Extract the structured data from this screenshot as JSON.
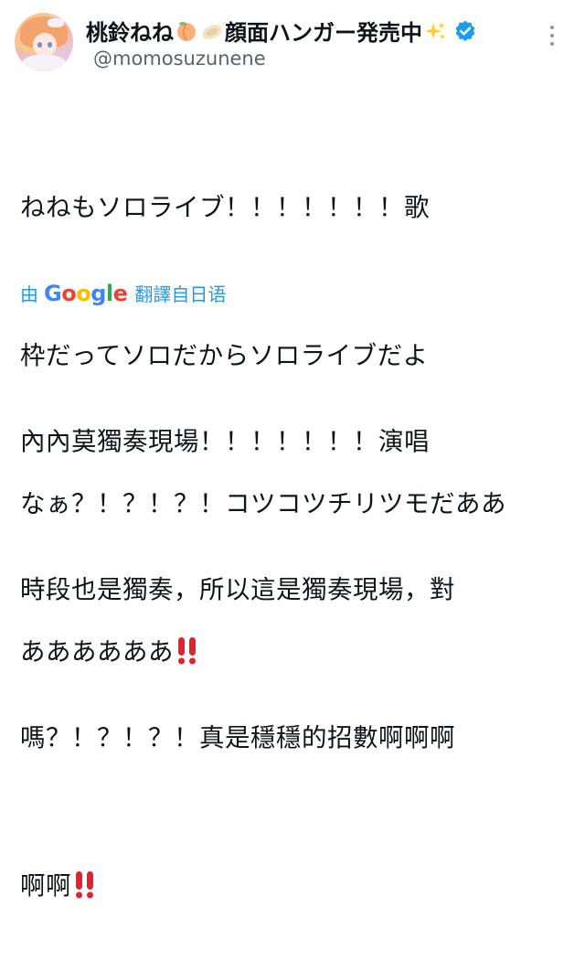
{
  "author": {
    "display_name": "桃鈴ねね",
    "display_name_suffix": "顔面ハンガー発売中",
    "handle": "@momosuzunene",
    "name_emoji_icons": [
      "peach-icon",
      "hanger-icon",
      "sparkles-icon"
    ],
    "verified": true
  },
  "tweet": {
    "lines": [
      "ねねもソロライブ！！！！！！！歌",
      "枠だってソロだからソロライブだよ",
      "なぁ？！？！？！コツコツチリツモだああ",
      "ああああああ"
    ],
    "trailing_emoji": "double-exclamation-icon"
  },
  "translation_bar": {
    "prefix": "由",
    "provider": "Google",
    "suffix": "翻譯自日语"
  },
  "translation": {
    "lines": [
      "內內莫獨奏現場！！！！！！！演唱",
      "時段也是獨奏，所以這是獨奏現場，對",
      "嗎？！？！？！真是穩穩的招數啊啊啊",
      "啊啊"
    ],
    "trailing_emoji": "double-exclamation-icon"
  },
  "colors": {
    "text": "#0f1419",
    "secondary": "#536471",
    "link": "#1d9bf0",
    "verified": "#1d9bf0",
    "exclaim": "#e0232e"
  }
}
